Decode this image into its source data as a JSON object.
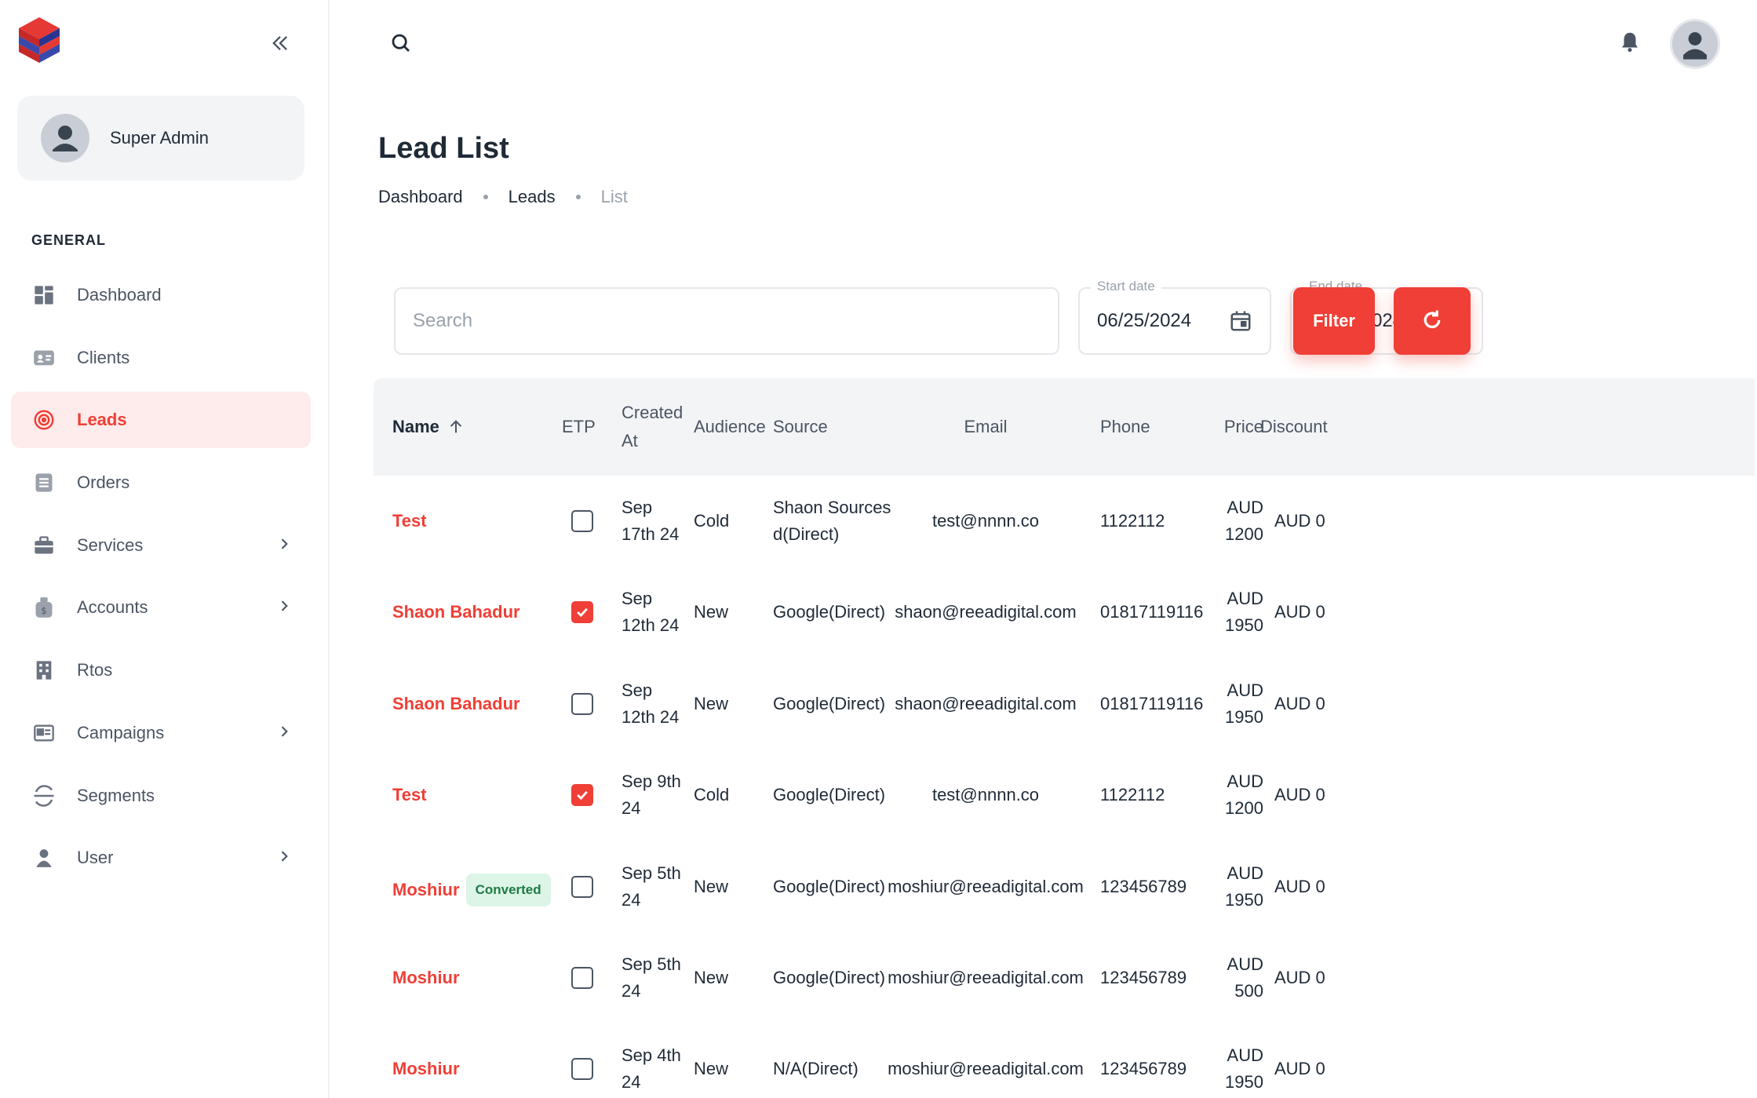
{
  "sidebar": {
    "user_name": "Super Admin",
    "section_title": "GENERAL",
    "items": [
      {
        "label": "Dashboard",
        "icon": "dashboard-icon"
      },
      {
        "label": "Clients",
        "icon": "id-card-icon"
      },
      {
        "label": "Leads",
        "icon": "target-icon"
      },
      {
        "label": "Orders",
        "icon": "list-icon"
      },
      {
        "label": "Services",
        "icon": "briefcase-icon"
      },
      {
        "label": "Accounts",
        "icon": "money-bag-icon"
      },
      {
        "label": "Rtos",
        "icon": "building-icon"
      },
      {
        "label": "Campaigns",
        "icon": "campaign-icon"
      },
      {
        "label": "Segments",
        "icon": "segments-icon"
      },
      {
        "label": "User",
        "icon": "user-icon"
      }
    ]
  },
  "page": {
    "title": "Lead List",
    "breadcrumb": [
      "Dashboard",
      "Leads",
      "List"
    ]
  },
  "filters": {
    "search_placeholder": "Search",
    "start_label": "Start date",
    "start_value": "06/25/2024",
    "end_label": "End date",
    "end_value": "09/23/2024",
    "filter_label": "Filter"
  },
  "table": {
    "headers": {
      "name": "Name",
      "etp": "ETP",
      "created_1": "Created",
      "created_2": "At",
      "audience": "Audience",
      "source": "Source",
      "email": "Email",
      "phone": "Phone",
      "price": "Price",
      "discount": "Discount"
    },
    "rows": [
      {
        "name": "Test",
        "badge": "",
        "etp": false,
        "created_1": "Sep",
        "created_2": "17th 24",
        "audience": "Cold",
        "source_1": "Shaon Sources",
        "source_2": "d(Direct)",
        "email": "test@nnnn.co",
        "phone": "1122112",
        "price_1": "AUD",
        "price_2": "1200",
        "discount": "AUD 0"
      },
      {
        "name": "Shaon Bahadur",
        "badge": "",
        "etp": true,
        "created_1": "Sep",
        "created_2": "12th 24",
        "audience": "New",
        "source_1": "Google(Direct)",
        "source_2": "",
        "email": "shaon@reeadigital.com",
        "phone": "01817119116",
        "price_1": "AUD",
        "price_2": "1950",
        "discount": "AUD 0"
      },
      {
        "name": "Shaon Bahadur",
        "badge": "",
        "etp": false,
        "created_1": "Sep",
        "created_2": "12th 24",
        "audience": "New",
        "source_1": "Google(Direct)",
        "source_2": "",
        "email": "shaon@reeadigital.com",
        "phone": "01817119116",
        "price_1": "AUD",
        "price_2": "1950",
        "discount": "AUD 0"
      },
      {
        "name": "Test",
        "badge": "",
        "etp": true,
        "created_1": "Sep 9th",
        "created_2": "24",
        "audience": "Cold",
        "source_1": "Google(Direct)",
        "source_2": "",
        "email": "test@nnnn.co",
        "phone": "1122112",
        "price_1": "AUD",
        "price_2": "1200",
        "discount": "AUD 0"
      },
      {
        "name": "Moshiur",
        "badge": "Converted",
        "etp": false,
        "created_1": "Sep 5th",
        "created_2": "24",
        "audience": "New",
        "source_1": "Google(Direct)",
        "source_2": "",
        "email": "moshiur@reeadigital.com",
        "phone": "123456789",
        "price_1": "AUD",
        "price_2": "1950",
        "discount": "AUD 0"
      },
      {
        "name": "Moshiur",
        "badge": "",
        "etp": false,
        "created_1": "Sep 5th",
        "created_2": "24",
        "audience": "New",
        "source_1": "Google(Direct)",
        "source_2": "",
        "email": "moshiur@reeadigital.com",
        "phone": "123456789",
        "price_1": "AUD",
        "price_2": "500",
        "discount": "AUD 0"
      },
      {
        "name": "Moshiur",
        "badge": "",
        "etp": false,
        "created_1": "Sep 4th",
        "created_2": "24",
        "audience": "New",
        "source_1": "N/A(Direct)",
        "source_2": "",
        "email": "moshiur@reeadigital.com",
        "phone": "123456789",
        "price_1": "AUD",
        "price_2": "1950",
        "discount": "AUD 0"
      }
    ]
  },
  "colors": {
    "accent": "#ef3f36",
    "badge_bg": "#dcf5e6",
    "badge_text": "#1f7a45"
  }
}
